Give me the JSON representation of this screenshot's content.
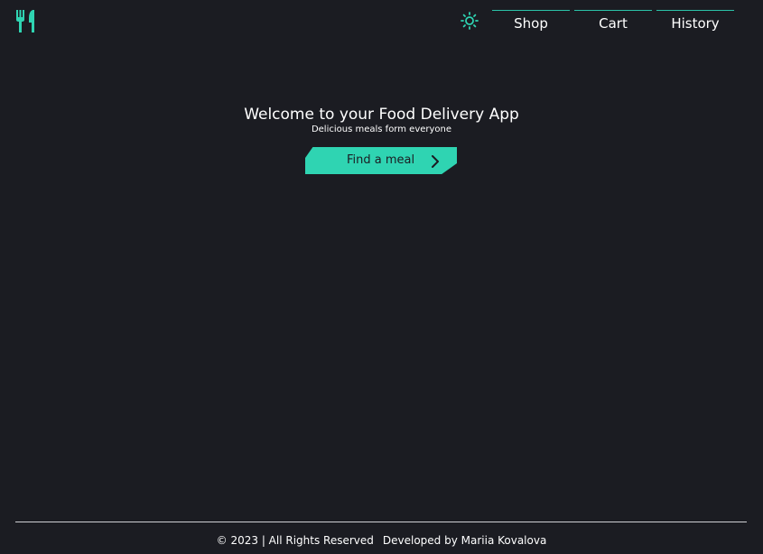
{
  "header": {
    "logo_icon": "fork-and-knife-icon",
    "theme_icon": "sun-icon",
    "nav": [
      {
        "label": "Shop"
      },
      {
        "label": "Cart"
      },
      {
        "label": "History"
      }
    ]
  },
  "hero": {
    "title": "Welcome to your Food Delivery App",
    "subtitle": "Delicious meals form everyone",
    "cta_label": "Find a meal",
    "cta_icon": "chevron-right-icon"
  },
  "footer": {
    "copyright": "© 2023 | All Rights Reserved",
    "developer": "Developed by Mariia Kovalova"
  },
  "colors": {
    "background": "#1b1c22",
    "accent": "#2fd4b2",
    "text": "#ffffff"
  }
}
